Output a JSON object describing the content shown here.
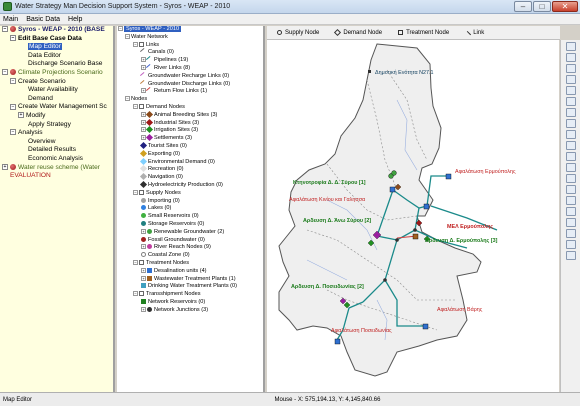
{
  "window": {
    "title": "Water Strategy Man Decision Support System - Syros - WEAP - 2010"
  },
  "menu": [
    "Main",
    "Basic Data",
    "Help"
  ],
  "left_tree": {
    "root": "Syros - WEAP - 2010 (BASE",
    "edit_base": "Edit Base Case Data",
    "map_editor": "Map Editor",
    "data_editor": "Data Editor",
    "discharge": "Discharge Scenario Base",
    "climate": "Climate Projections Scenario",
    "create_scenario": "Create Scenario",
    "water_avail": "Water Availability",
    "demand": "Demand",
    "create_wms": "Create Water Management Sc",
    "modify": "Modify",
    "apply": "Apply Strategy",
    "analysis": "Analysis",
    "overview": "Overview",
    "detailed": "Detailed Results",
    "economic": "Economic Analysis",
    "reuse": "Water reuse scheme (Water",
    "evaluation": "EVALUATION"
  },
  "mid_tree": {
    "root": "Syros - WEAP - 2010",
    "water_network": "Water Network",
    "links": "Links",
    "canals": "Canals (0)",
    "pipelines": "Pipelines (19)",
    "river_links": "River Links (8)",
    "gw_recharge": "Groundwater Recharge Links (0)",
    "gw_discharge": "Groundwater Discharge Links (0)",
    "return_flow": "Return Flow Links (1)",
    "nodes": "Nodes",
    "demand_nodes": "Demand Nodes",
    "animal": "Animal Breeding Sites (3)",
    "industrial": "Industrial Sites (3)",
    "irrigation": "Irrigation Sites (3)",
    "settlements": "Settlements (3)",
    "tourist": "Tourist Sites (0)",
    "exporting": "Exporting (0)",
    "env_demand": "Environmental Demand (0)",
    "recreation": "Recreation (0)",
    "navigation": "Navigation (0)",
    "hydro": "Hydroelectricity Production (0)",
    "supply_nodes": "Supply Nodes",
    "importing": "Importing (0)",
    "lakes": "Lakes (0)",
    "small_res": "Small Reservoirs (0)",
    "storage_res": "Storage Reservoirs (0)",
    "renew_gw": "Renewable Groundwater (2)",
    "fossil_gw": "Fossil Groundwater (0)",
    "river_reach": "River Reach Nodes (9)",
    "coastal": "Coastal Zone (0)",
    "treatment_nodes": "Treatment Nodes",
    "desal": "Desalination units (4)",
    "wwtp": "Wastewater Treatment Plants (1)",
    "dwtp": "Drinking Water Treatment Plants (0)",
    "transship": "Transshipment Nodes",
    "net_res": "Network Reservoirs (0)",
    "net_junc": "Network Junctions (3)"
  },
  "map_toolbar": [
    "Supply Node",
    "Demand Node",
    "Treatment Node",
    "Link"
  ],
  "map_labels": {
    "hermoupoli_unit": "Δημοτική Ενότητα Ν27.1",
    "kt_syros": "Κτηνοτροφία Δ. Δ. Σύρου [1]",
    "desal_ermoupolis": "Αφαλάτωση Ερμούπολης",
    "desal_kini": "Αφαλάτωση Κινίου και Γαλησσα",
    "ardeusi_ano": "Αρδευση Δ. Άνω Σύρου [2]",
    "wwtp_ermoupolis": "ΜΕΛ Ερμούπολης",
    "ardeusi_ermoupolis": "Αρδευση Δ. Ερμούπολης [3]",
    "ardeusi_poseidonias": "Αρδευση Δ. Ποσειδωνίας [2]",
    "desal_varis": "Αφαλάτωση Βάρης",
    "desal_poseidonias": "Αφαλάτωση Ποσειδωνίας"
  },
  "status": {
    "left": "Map Editor",
    "coords": "Mouse - X: 575,194.13, Y: 4,145,840.66"
  }
}
